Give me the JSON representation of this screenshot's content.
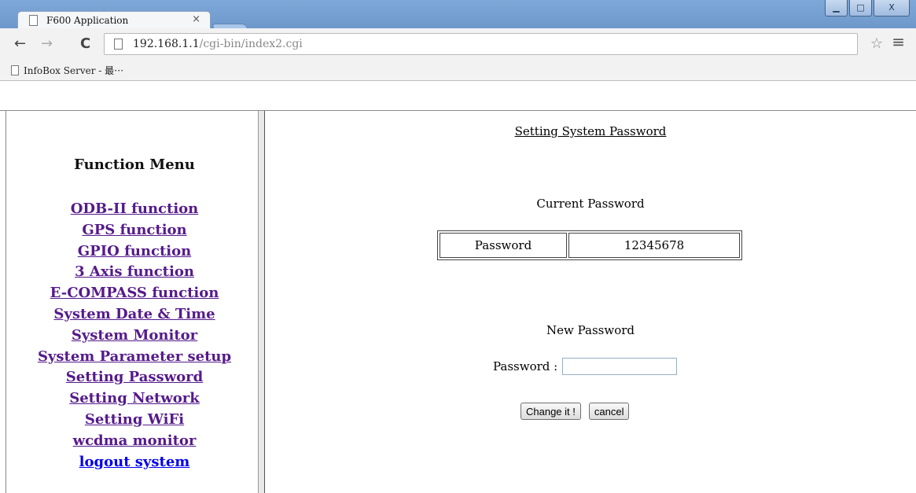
{
  "browser": {
    "tab_title": "F600 Application",
    "tab_close": "×",
    "url_host": "192.168.1.1",
    "url_path": "/cgi-bin/index2.cgi",
    "bookmark_label": "InfoBox Server - 最⋯",
    "back_icon": "←",
    "forward_icon": "→",
    "reload_icon": "C",
    "star_icon": "☆",
    "menu_icon": "≡",
    "minimize_icon": "▁",
    "maximize_icon": "□",
    "close_icon": "X"
  },
  "sidebar": {
    "heading": "Function Menu",
    "items": [
      {
        "label": "ODB-II function"
      },
      {
        "label": "GPS function"
      },
      {
        "label": "GPIO function"
      },
      {
        "label": "3 Axis function"
      },
      {
        "label": "E-COMPASS function"
      },
      {
        "label": "System Date & Time"
      },
      {
        "label": "System Monitor"
      },
      {
        "label": "System Parameter setup"
      },
      {
        "label": "Setting Password"
      },
      {
        "label": "Setting Network"
      },
      {
        "label": "Setting WiFi"
      },
      {
        "label": "wcdma monitor"
      },
      {
        "label": "logout system"
      }
    ]
  },
  "main": {
    "title": "Setting System Password",
    "current_section": "Current Password",
    "current_table": {
      "label": "Password",
      "value": "12345678"
    },
    "new_section": "New Password",
    "new_password_label": "Password :",
    "new_password_value": "",
    "change_button": "Change it !",
    "cancel_button": "cancel"
  }
}
